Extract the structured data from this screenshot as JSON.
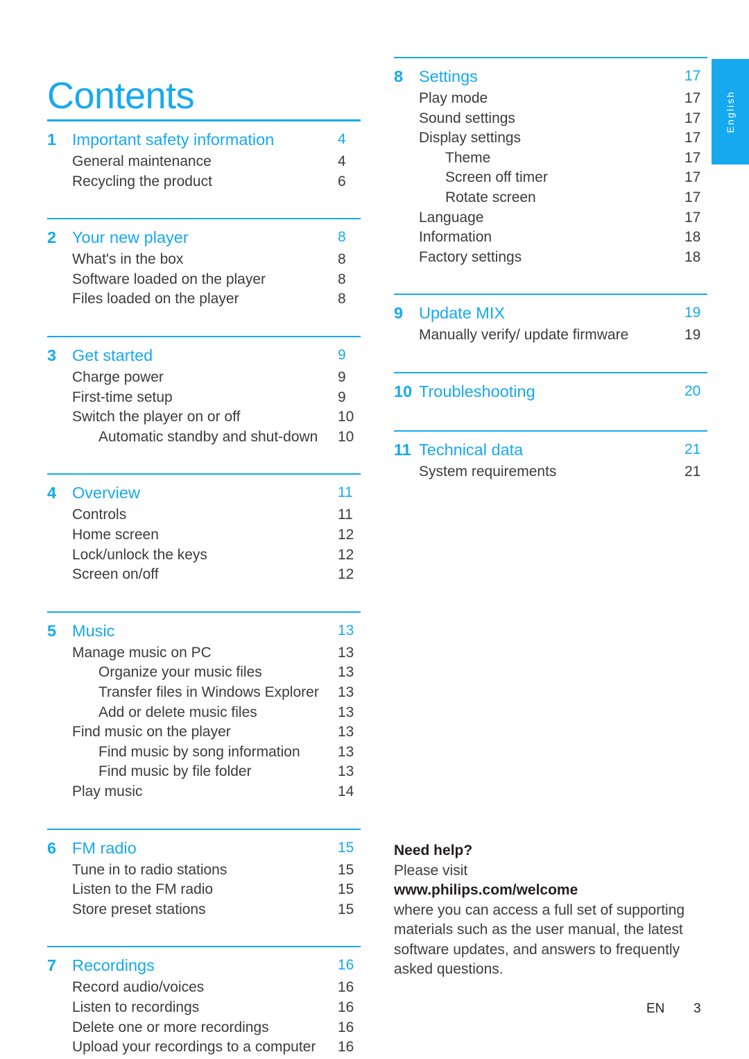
{
  "page": {
    "title": "Contents",
    "language_tab": "English",
    "footer": {
      "locale": "EN",
      "page_number": "3"
    },
    "accent_color": "#16a9ef",
    "text_color": "#3b3b3b"
  },
  "left_column": [
    {
      "rule": "thick",
      "number": "1",
      "title": "Important safety information",
      "page": "4",
      "items": [
        {
          "level": 1,
          "label": "General maintenance",
          "page": "4"
        },
        {
          "level": 1,
          "label": "Recycling the product",
          "page": "6"
        }
      ]
    },
    {
      "rule": "thin",
      "number": "2",
      "title": "Your new player",
      "page": "8",
      "items": [
        {
          "level": 1,
          "label": "What's in the box",
          "page": "8"
        },
        {
          "level": 1,
          "label": "Software loaded on the player",
          "page": "8"
        },
        {
          "level": 1,
          "label": "Files loaded on the player",
          "page": "8"
        }
      ]
    },
    {
      "rule": "thin",
      "number": "3",
      "title": "Get started",
      "page": "9",
      "items": [
        {
          "level": 1,
          "label": "Charge power",
          "page": "9"
        },
        {
          "level": 1,
          "label": "First-time setup",
          "page": "9"
        },
        {
          "level": 1,
          "label": "Switch the player on or off",
          "page": "10"
        },
        {
          "level": 2,
          "label": "Automatic standby and shut-down",
          "page": "10"
        }
      ]
    },
    {
      "rule": "thin",
      "number": "4",
      "title": "Overview",
      "page": "11",
      "items": [
        {
          "level": 1,
          "label": "Controls",
          "page": "11"
        },
        {
          "level": 1,
          "label": "Home screen",
          "page": "12"
        },
        {
          "level": 1,
          "label": "Lock/unlock the keys",
          "page": "12"
        },
        {
          "level": 1,
          "label": "Screen on/off",
          "page": "12"
        }
      ]
    },
    {
      "rule": "thin",
      "number": "5",
      "title": "Music",
      "page": "13",
      "items": [
        {
          "level": 1,
          "label": "Manage music on PC",
          "page": "13"
        },
        {
          "level": 2,
          "label": "Organize your music files",
          "page": "13"
        },
        {
          "level": 2,
          "label": "Transfer files in Windows Explorer",
          "page": "13"
        },
        {
          "level": 2,
          "label": "Add or delete music files",
          "page": "13"
        },
        {
          "level": 1,
          "label": "Find music on the player",
          "page": "13"
        },
        {
          "level": 2,
          "label": "Find music by song information",
          "page": "13"
        },
        {
          "level": 2,
          "label": "Find music by file folder",
          "page": "13"
        },
        {
          "level": 1,
          "label": "Play music",
          "page": "14"
        }
      ]
    },
    {
      "rule": "thin",
      "number": "6",
      "title": "FM radio",
      "page": "15",
      "items": [
        {
          "level": 1,
          "label": "Tune in to radio stations",
          "page": "15"
        },
        {
          "level": 1,
          "label": "Listen to the FM radio",
          "page": "15"
        },
        {
          "level": 1,
          "label": "Store preset stations",
          "page": "15"
        }
      ]
    },
    {
      "rule": "thin",
      "number": "7",
      "title": "Recordings",
      "page": "16",
      "items": [
        {
          "level": 1,
          "label": "Record audio/voices",
          "page": "16"
        },
        {
          "level": 1,
          "label": "Listen to recordings",
          "page": "16"
        },
        {
          "level": 1,
          "label": "Delete one or more recordings",
          "page": "16"
        },
        {
          "level": 1,
          "label": "Upload your recordings to a computer",
          "page": "16"
        }
      ]
    }
  ],
  "right_column": [
    {
      "rule": "thin",
      "number": "8",
      "title": "Settings",
      "page": "17",
      "items": [
        {
          "level": 1,
          "label": "Play mode",
          "page": "17"
        },
        {
          "level": 1,
          "label": "Sound settings",
          "page": "17"
        },
        {
          "level": 1,
          "label": "Display settings",
          "page": "17"
        },
        {
          "level": 2,
          "label": "Theme",
          "page": "17"
        },
        {
          "level": 2,
          "label": "Screen off timer",
          "page": "17"
        },
        {
          "level": 2,
          "label": "Rotate screen",
          "page": "17"
        },
        {
          "level": 1,
          "label": "Language",
          "page": "17"
        },
        {
          "level": 1,
          "label": "Information",
          "page": "18"
        },
        {
          "level": 1,
          "label": "Factory settings",
          "page": "18"
        }
      ]
    },
    {
      "rule": "thin",
      "number": "9",
      "title": "Update MIX",
      "page": "19",
      "items": [
        {
          "level": 1,
          "label": "Manually verify/ update firmware",
          "page": "19"
        }
      ]
    },
    {
      "rule": "thin",
      "number": "10",
      "title": "Troubleshooting",
      "page": "20",
      "items": []
    },
    {
      "rule": "thin",
      "number": "11",
      "title": "Technical data",
      "page": "21",
      "items": [
        {
          "level": 1,
          "label": "System requirements",
          "page": "21"
        }
      ]
    }
  ],
  "need_help": {
    "title": "Need help?",
    "line_visit": "Please visit",
    "url": "www.philips.com/welcome",
    "body": "where you can access a full set of supporting materials such as the user manual, the latest software updates, and answers to frequently asked questions."
  }
}
